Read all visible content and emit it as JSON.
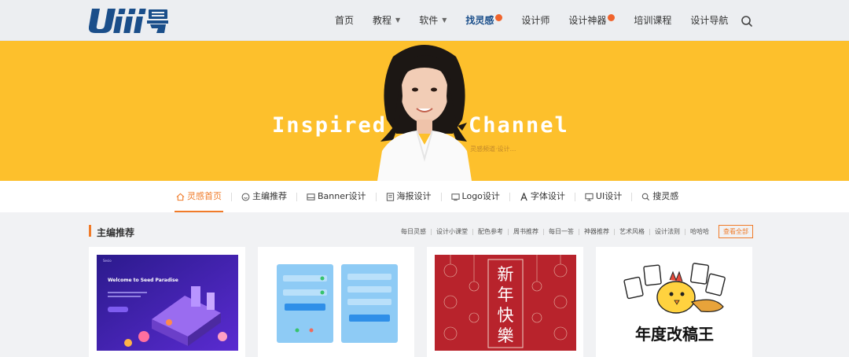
{
  "brand": {
    "logo_text": "Uiii",
    "logo_mark": "号",
    "logo_color": "#1a4e8a"
  },
  "nav": {
    "items": [
      {
        "label": "首页",
        "caret": ""
      },
      {
        "label": "教程",
        "caret": "▼"
      },
      {
        "label": "软件",
        "caret": "▼"
      },
      {
        "label": "找灵感",
        "caret": "",
        "badge": ""
      },
      {
        "label": "设计师",
        "caret": ""
      },
      {
        "label": "设计神器",
        "caret": "",
        "badge": ""
      },
      {
        "label": "培训课程",
        "caret": ""
      },
      {
        "label": "设计导航",
        "caret": ""
      }
    ],
    "search_icon": "search-icon"
  },
  "banner": {
    "left_text": "Inspired",
    "right_text": "Channel",
    "caption": "灵感频道·设计…",
    "background": "#fdc02c"
  },
  "subnav": {
    "items": [
      {
        "label": "灵感首页",
        "icon": "home-icon"
      },
      {
        "label": "主编推荐",
        "icon": "smile-icon"
      },
      {
        "label": "Banner设计",
        "icon": "image-icon"
      },
      {
        "label": "海报设计",
        "icon": "poster-icon"
      },
      {
        "label": "Logo设计",
        "icon": "monitor-icon"
      },
      {
        "label": "字体设计",
        "icon": "font-icon"
      },
      {
        "label": "UI设计",
        "icon": "desktop-icon"
      },
      {
        "label": "搜灵感",
        "icon": "search-icon"
      }
    ]
  },
  "section": {
    "title": "主编推荐",
    "tags": [
      "每日灵感",
      "设计小课堂",
      "配色参考",
      "周书推荐",
      "每日一答",
      "神器推荐",
      "艺术风格",
      "设计法则",
      "哈哈哈"
    ],
    "view_all": "查看全部"
  },
  "cards": [
    {
      "thumb_heading": "Welcome to Seed Paradise",
      "thumb_brand": "Sesio",
      "thumb_button": ""
    },
    {
      "thumb_left_button": "",
      "thumb_right_button": ""
    },
    {
      "thumb_text": [
        "新",
        "年",
        "快",
        "樂"
      ]
    },
    {
      "thumb_text": "年度改稿王"
    }
  ]
}
